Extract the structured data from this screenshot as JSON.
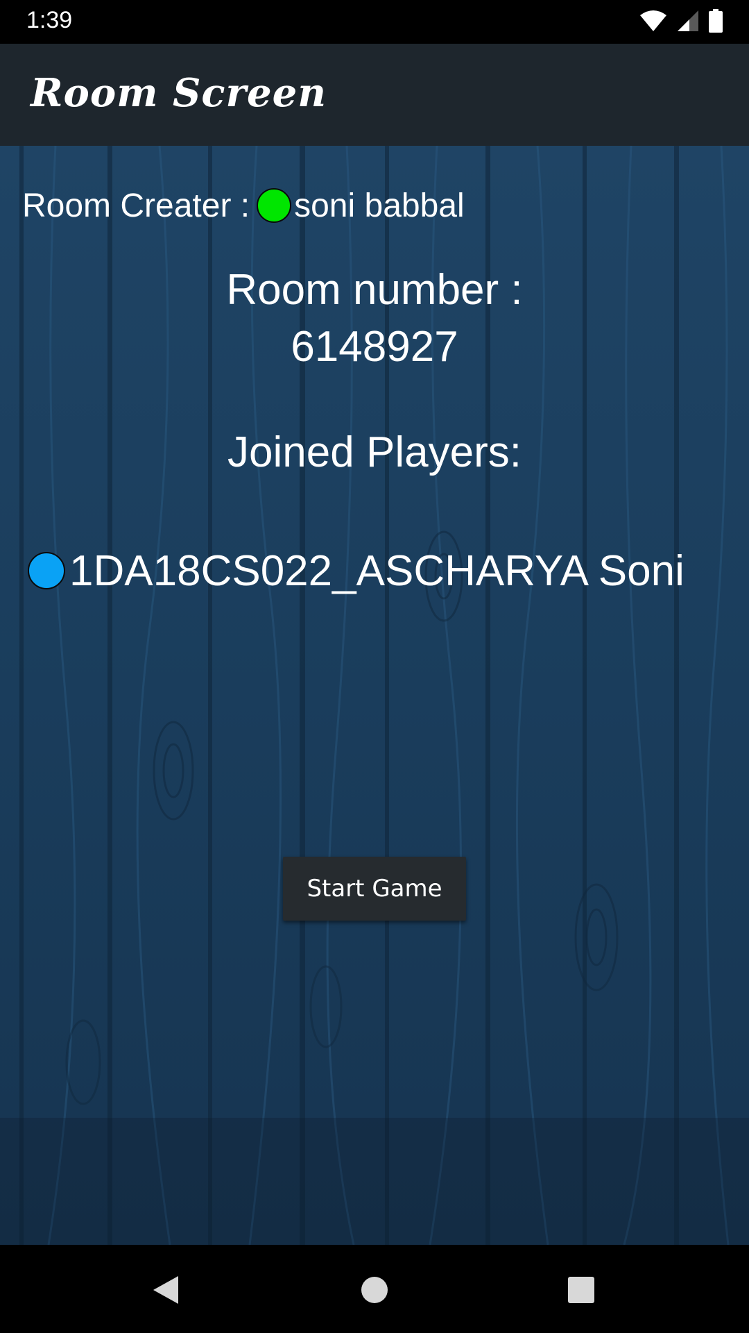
{
  "status_bar": {
    "time": "1:39",
    "icons": [
      "wifi-icon",
      "signal-icon",
      "battery-icon"
    ]
  },
  "app_bar": {
    "title": "Room Screen"
  },
  "creator": {
    "label": "Room Creater : ",
    "name": "soni babbal",
    "status_color": "#00e600"
  },
  "room": {
    "label": "Room number :",
    "number": "6148927"
  },
  "players": {
    "label": "Joined Players:",
    "items": [
      {
        "name": "1DA18CS022_ASCHARYA Soni",
        "status_color": "#0aa2f5"
      }
    ]
  },
  "actions": {
    "start_label": "Start Game"
  },
  "nav_bar": {
    "icons": [
      "back-icon",
      "home-icon",
      "recents-icon"
    ]
  },
  "colors": {
    "app_bar_bg": "#1e262d",
    "content_bg": "#1b3b58",
    "button_bg": "#262b2f"
  }
}
